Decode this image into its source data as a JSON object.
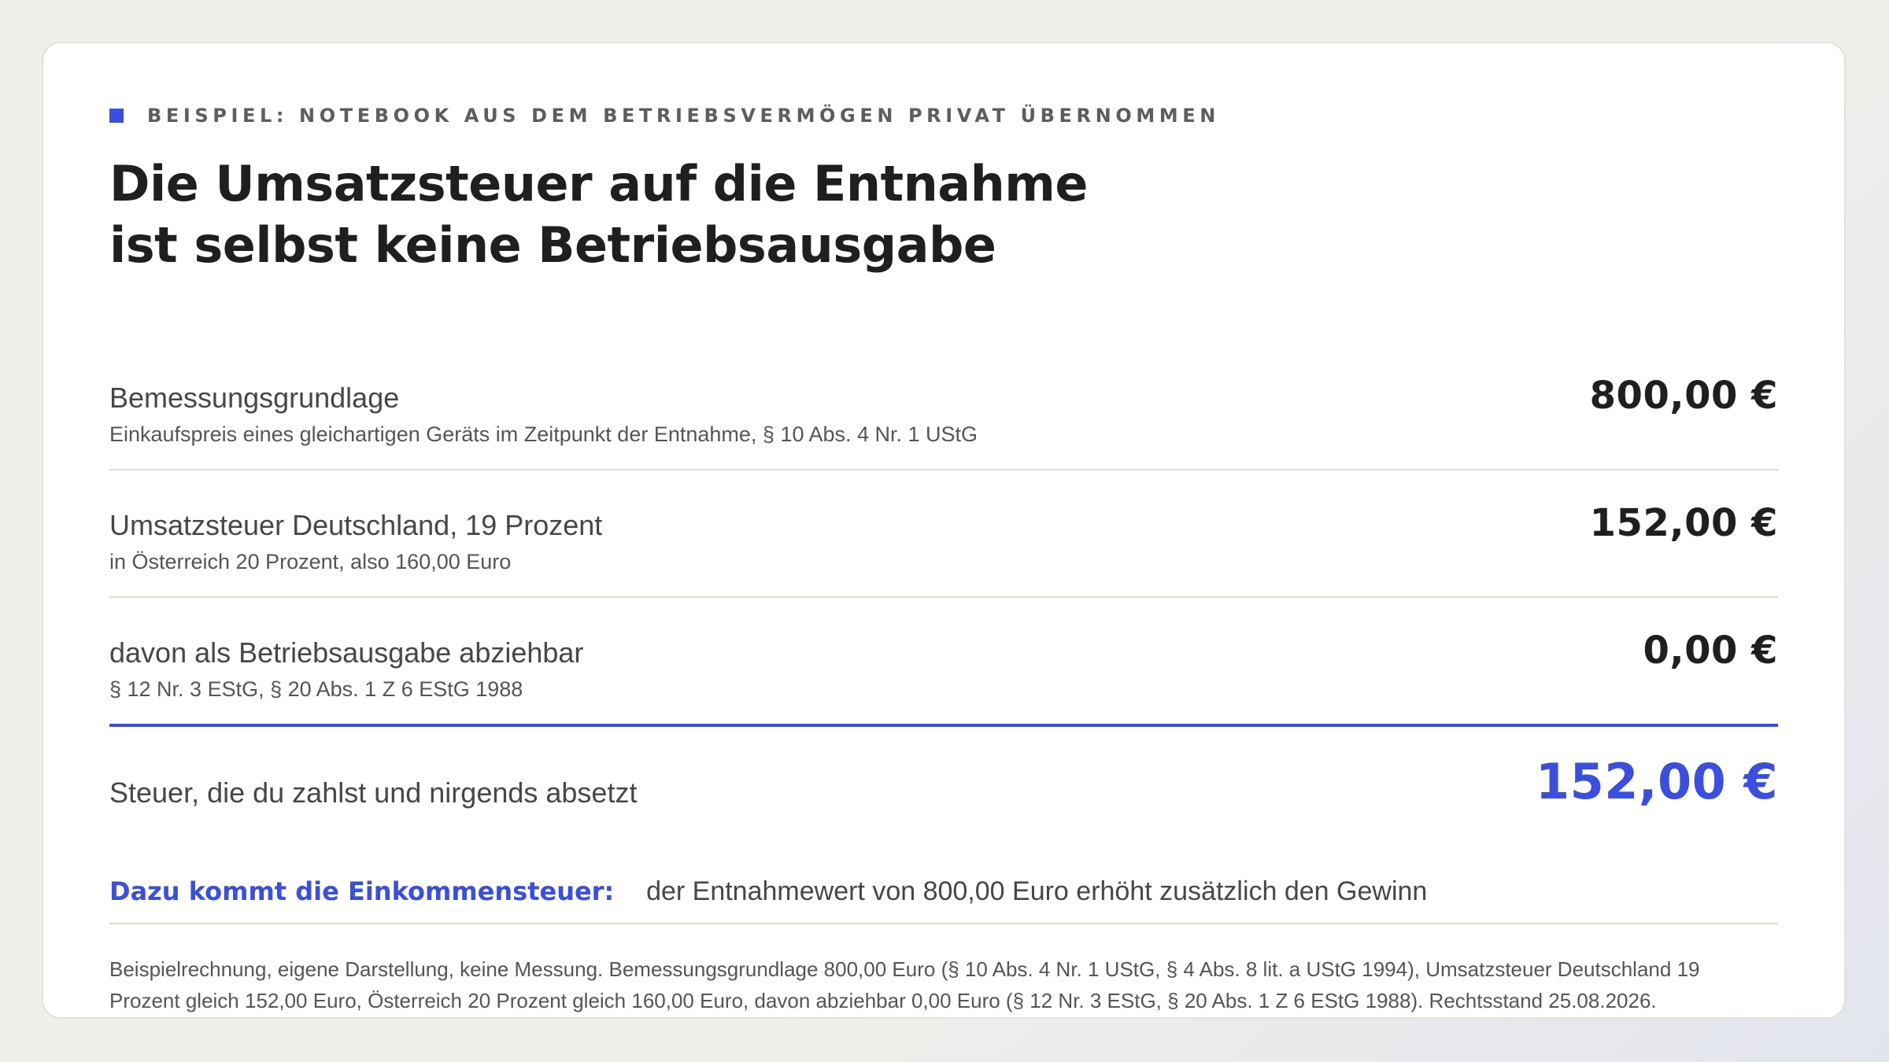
{
  "eyebrow": "BEISPIEL: NOTEBOOK AUS DEM BETRIEBSVERMÖGEN PRIVAT ÜBERNOMMEN",
  "title": {
    "line1": "Die Umsatzsteuer auf die Entnahme",
    "line2": "ist selbst keine Betriebsausgabe"
  },
  "rows": [
    {
      "label": "Bemessungsgrundlage",
      "sub": "Einkaufspreis eines gleichartigen Geräts im Zeitpunkt der Entnahme, § 10 Abs. 4 Nr. 1 UStG",
      "value": "800,00 €"
    },
    {
      "label": "Umsatzsteuer Deutschland, 19 Prozent",
      "sub": "in Österreich 20 Prozent, also 160,00 Euro",
      "value": "152,00 €"
    },
    {
      "label": "davon als Betriebsausgabe abziehbar",
      "sub": "§ 12 Nr. 3 EStG, § 20 Abs. 1 Z 6 EStG 1988",
      "value": "0,00 €"
    }
  ],
  "total": {
    "label": "Steuer, die du zahlst und nirgends absetzt",
    "value": "152,00 €"
  },
  "note": {
    "strong": "Dazu kommt die Einkommensteuer:",
    "text": "der Entnahmewert von 800,00 Euro erhöht zusätzlich den Gewinn"
  },
  "footnote": {
    "line1": "Beispielrechnung, eigene Darstellung, keine Messung. Bemessungsgrundlage 800,00 Euro (§ 10 Abs. 4 Nr. 1 UStG, § 4 Abs. 8 lit. a UStG 1994), Umsatzsteuer Deutschland 19",
    "line2": "Prozent gleich 152,00 Euro, Österreich 20 Prozent gleich 160,00 Euro, davon abziehbar 0,00 Euro (§ 12 Nr. 3 EStG, § 20 Abs. 1 Z 6 EStG 1988). Rechtsstand 25.08.2026."
  },
  "colors": {
    "accent": "#3a4fe0",
    "text": "#1f1f1f",
    "muted": "#555555",
    "divider": "#dedbd3"
  }
}
